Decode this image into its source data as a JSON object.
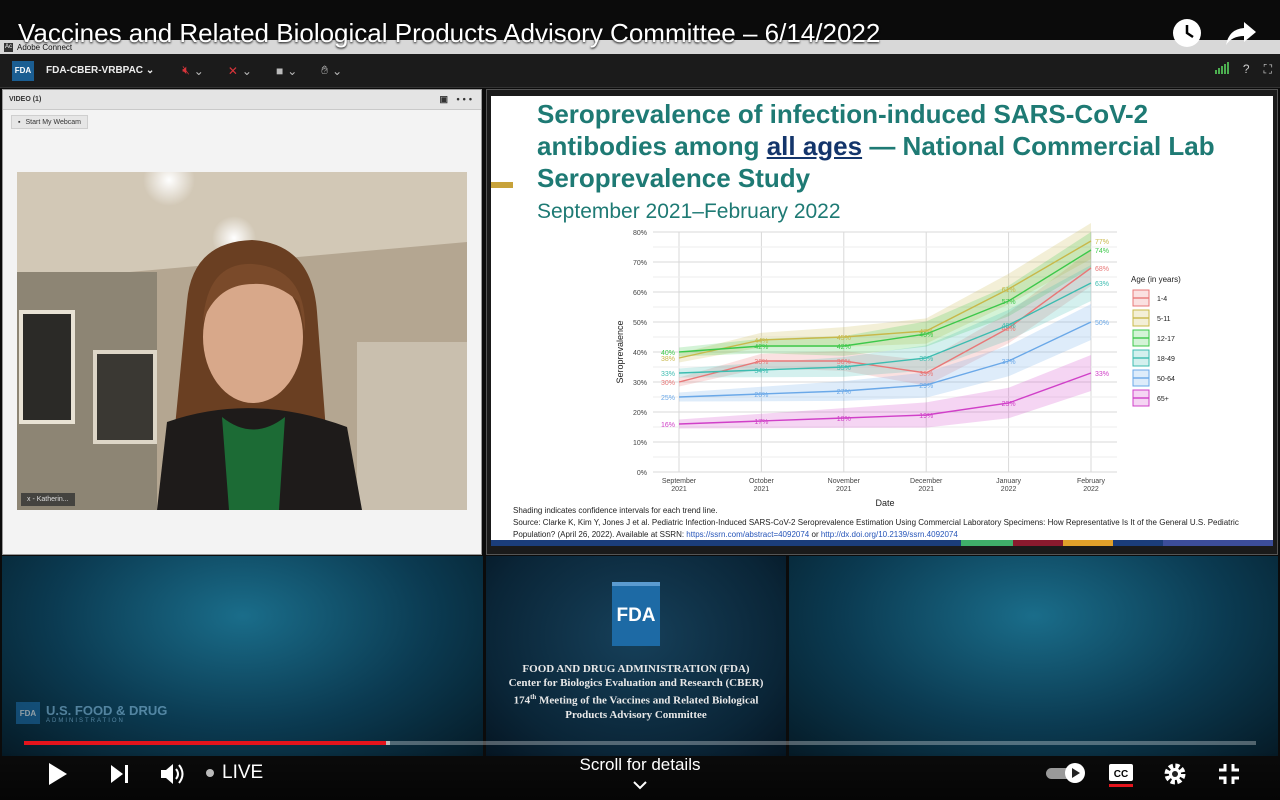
{
  "youtube": {
    "video_title": "Vaccines and Related Biological Products Advisory Committee – 6/14/2022",
    "live_label": "LIVE",
    "scroll_label": "Scroll for details",
    "progress_fraction": 0.294
  },
  "adobe_connect": {
    "app_title": "Adobe Connect",
    "room_badge": "FDA",
    "room_name": "FDA-CBER-VRBPAC"
  },
  "video_pod": {
    "header": "VIDEO (1)",
    "webcam_button": "Start My Webcam",
    "nametag": "x - Katherin..."
  },
  "slide": {
    "title_part1": "Seroprevalence of infection-induced SARS-CoV-2 antibodies among ",
    "title_emphasis": "all ages",
    "title_part2": " — National Commercial Lab Seroprevalence Study",
    "subtitle": "September 2021–February 2022",
    "shading_note": "Shading indicates confidence intervals for each trend line.",
    "source_text": "Source: Clarke K, Kim Y, Jones J et al.  Pediatric Infection-Induced SARS-CoV-2 Seroprevalence Estimation Using Commercial Laboratory Specimens: How Representative Is It of the General U.S. Pediatric Population? (April 26, 2022). Available at SSRN: ",
    "source_link1": "https://ssrn.com/abstract=4092074",
    "source_or": " or ",
    "source_link2": "http://dx.doi.org/10.2139/ssrn.4092074",
    "bottom_bar_colors": [
      "#1b3d7a",
      "#3fae6a",
      "#8a1a2e",
      "#e0a02a",
      "#1b3d7a",
      "#3c4d9a"
    ]
  },
  "chart_data": {
    "type": "line",
    "title": "",
    "xlabel": "Date",
    "ylabel": "Seroprevalence",
    "categories": [
      "September\n2021",
      "October\n2021",
      "November\n2021",
      "December\n2021",
      "January\n2022",
      "February\n2022"
    ],
    "x_tick_line1": [
      "September",
      "October",
      "November",
      "December",
      "January",
      "February"
    ],
    "x_tick_line2": [
      "2021",
      "2021",
      "2021",
      "2021",
      "2022",
      "2022"
    ],
    "y_ticks": [
      "0%",
      "10%",
      "20%",
      "30%",
      "40%",
      "50%",
      "60%",
      "70%",
      "80%"
    ],
    "ylim": [
      0,
      80
    ],
    "legend_title": "Age (in years)",
    "legend_position": "right",
    "grid": true,
    "series": [
      {
        "name": "1-4",
        "color": "#e87878",
        "values": [
          30,
          37,
          37,
          33,
          48,
          68
        ],
        "labels": [
          "30%",
          "36%",
          "36%",
          "33%",
          "48%",
          "68%"
        ]
      },
      {
        "name": "5-11",
        "color": "#c8b84a",
        "values": [
          38,
          44,
          45,
          47,
          61,
          77
        ],
        "labels": [
          "38%",
          "44%",
          "45%",
          "47%",
          "61%",
          "77%"
        ]
      },
      {
        "name": "12-17",
        "color": "#3cc84a",
        "values": [
          40,
          42,
          42,
          46,
          57,
          74
        ],
        "labels": [
          "40%",
          "42%",
          "42%",
          "46%",
          "57%",
          "74%"
        ]
      },
      {
        "name": "18-49",
        "color": "#3cbcb0",
        "values": [
          33,
          34,
          35,
          38,
          49,
          63
        ],
        "labels": [
          "33%",
          "34%",
          "35%",
          "38%",
          "49%",
          "63%"
        ]
      },
      {
        "name": "50-64",
        "color": "#6aa8e8",
        "values": [
          25,
          26,
          27,
          29,
          37,
          50
        ],
        "labels": [
          "25%",
          "26%",
          "27%",
          "29%",
          "37%",
          "50%"
        ]
      },
      {
        "name": "65+",
        "color": "#d040c8",
        "values": [
          16,
          17,
          18,
          19,
          23,
          33
        ],
        "labels": [
          "16%",
          "17%",
          "18%",
          "19%",
          "23%",
          "33%"
        ]
      }
    ]
  },
  "fda_panel": {
    "logo": "FDA",
    "line1": "FOOD AND DRUG ADMINISTRATION (FDA)",
    "line2": "Center for Biologics Evaluation and Research (CBER)",
    "line3_num": "174",
    "line3_sup": "th",
    "line3_rest": " Meeting of the Vaccines and Related Biological",
    "line4": "Products Advisory Committee"
  },
  "usfda_watermark": {
    "badge": "FDA",
    "name": "U.S. FOOD & DRUG",
    "sub": "ADMINISTRATION"
  }
}
